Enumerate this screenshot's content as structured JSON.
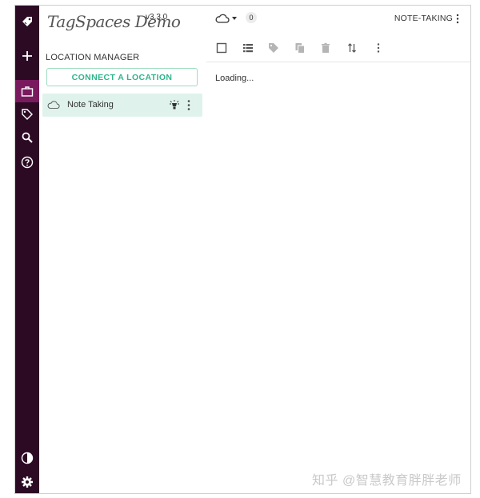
{
  "app": {
    "brand": "TagSpaces Demo",
    "version": "v3.3.0"
  },
  "rail": {
    "items": [
      {
        "icon": "tag-logo-icon"
      },
      {
        "icon": "plus-icon"
      },
      {
        "icon": "briefcase-icon",
        "active": true
      },
      {
        "icon": "tag-icon"
      },
      {
        "icon": "search-icon"
      },
      {
        "icon": "help-icon"
      },
      {
        "icon": "contrast-icon"
      },
      {
        "icon": "gear-icon"
      }
    ]
  },
  "location_manager": {
    "title": "LOCATION MANAGER",
    "connect_label": "CONNECT A LOCATION",
    "locations": [
      {
        "name": "Note Taking",
        "icon": "cloud-icon",
        "selected": true
      }
    ]
  },
  "main": {
    "count": "0",
    "location_label": "NOTE-TAKING",
    "loading_text": "Loading...",
    "toolbar_icons": [
      "checkbox-icon",
      "list-view-icon",
      "tag-icon",
      "copy-icon",
      "delete-icon",
      "sort-icon",
      "more-icon"
    ]
  },
  "watermark": "知乎 @智慧教育胖胖老师",
  "colors": {
    "rail_bg": "#2c0a24",
    "rail_active": "#7a1a5e",
    "accent": "#2fb68a",
    "selected_bg": "#dff3ec"
  }
}
